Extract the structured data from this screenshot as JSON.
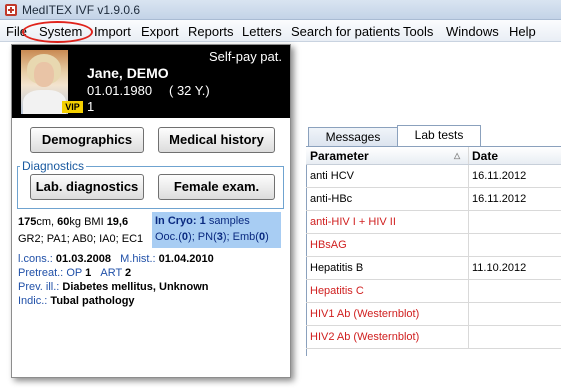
{
  "window": {
    "title": "MedITEX IVF v1.9.0.6",
    "icon": "app-icon"
  },
  "menu": [
    "File",
    "System",
    "Import",
    "Export",
    "Reports",
    "Letters",
    "Search for patients",
    "Tools",
    "Windows",
    "Help"
  ],
  "patient": {
    "billing": "Self-pay pat.",
    "name": "Jane, DEMO",
    "dob": "01.01.1980",
    "age": "( 32 Y.)",
    "number": "1",
    "vip": "VIP"
  },
  "buttons": {
    "demographics": "Demographics",
    "medical_history": "Medical history",
    "lab_diagnostics": "Lab. diagnostics",
    "female_exam": "Female exam."
  },
  "diagnostics_label": "Diagnostics",
  "vitals": {
    "height": "175",
    "height_unit": "cm, ",
    "weight": "60",
    "weight_unit": "kg BMI ",
    "bmi": "19,6",
    "obstetric": "GR2; PA1; AB0; IA0; EC1"
  },
  "cryo": {
    "label": "In Cryo:",
    "count": "1",
    "unit": "samples",
    "ooc_label": "Ooc.(",
    "ooc": "0",
    "pn_label": "); PN(",
    "pn": "3",
    "emb_label": "); Emb(",
    "emb": "0",
    "close": ")"
  },
  "info": {
    "lcons_label": "l.cons.:",
    "lcons": "01.03.2008",
    "mhist_label": "M.hist.:",
    "mhist": "01.04.2010",
    "pretreat_label": "Pretreat.:",
    "op_label": "OP",
    "op": "1",
    "art_label": "ART",
    "art": "2",
    "prev_label": "Prev. ill.:",
    "prev": "Diabetes mellitus, Unknown",
    "indic_label": "Indic.:",
    "indic": "Tubal pathology"
  },
  "tabs": {
    "messages": "Messages",
    "lab_tests": "Lab tests"
  },
  "table": {
    "headers": [
      "Parameter",
      "Date"
    ],
    "rows": [
      {
        "parameter": "anti HCV",
        "date": "16.11.2012",
        "red": false
      },
      {
        "parameter": "anti-HBc",
        "date": "16.11.2012",
        "red": false
      },
      {
        "parameter": "anti-HIV I + HIV II",
        "date": "",
        "red": true
      },
      {
        "parameter": "HBsAG",
        "date": "",
        "red": true
      },
      {
        "parameter": "Hepatitis B",
        "date": "11.10.2012",
        "red": false
      },
      {
        "parameter": "Hepatitis C",
        "date": "",
        "red": true
      },
      {
        "parameter": "HIV1 Ab (Westernblot)",
        "date": "",
        "red": true
      },
      {
        "parameter": "HIV2 Ab (Westernblot)",
        "date": "",
        "red": true
      }
    ]
  },
  "colors": {
    "highlight": "#e0231c",
    "missing": "#d02020",
    "cryo_bg": "#a8cdf3",
    "vip": "#f5d000"
  }
}
